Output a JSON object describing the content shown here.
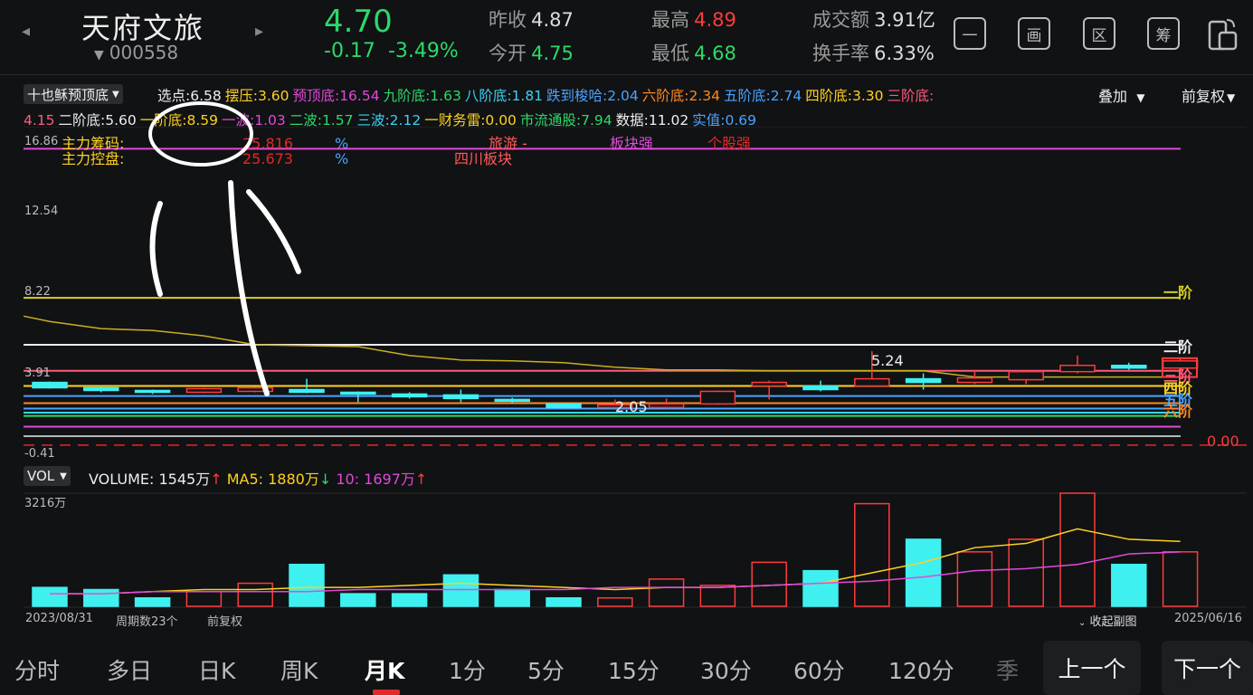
{
  "header": {
    "name": "天府文旅",
    "code": "000558",
    "price": "4.70",
    "change": "-0.17",
    "change_pct": "-3.49%",
    "quotes": [
      {
        "label": "昨收",
        "value": "4.87",
        "color": "#dddddd"
      },
      {
        "label": "今开",
        "value": "4.75",
        "color": "#2bd96a"
      },
      {
        "label": "最高",
        "value": "4.89",
        "color": "#ff3b3b"
      },
      {
        "label": "最低",
        "value": "4.68",
        "color": "#2bd96a"
      },
      {
        "label": "成交额",
        "value": "3.91亿",
        "color": "#dddddd"
      },
      {
        "label": "换手率",
        "value": "6.33%",
        "color": "#dddddd"
      }
    ],
    "tools": [
      "一",
      "画",
      "区",
      "筹"
    ]
  },
  "indicator": {
    "selector": "十也稣预顶底",
    "overlay": "叠加",
    "adjust": "前复权",
    "line1": [
      {
        "t": "选点:6.58",
        "c": "#eeeeee"
      },
      {
        "t": "摆压:3.60",
        "c": "#ffd21f"
      },
      {
        "t": "预顶底:16.54",
        "c": "#e04ad8"
      },
      {
        "t": "九阶底:1.63",
        "c": "#2bd96a"
      },
      {
        "t": "八阶底:1.81",
        "c": "#39d3f0"
      },
      {
        "t": "跌到梭哈:2.04",
        "c": "#4aa3ff"
      },
      {
        "t": "六阶底:2.34",
        "c": "#ff8a1f"
      },
      {
        "t": "五阶底:2.74",
        "c": "#4aa3ff"
      },
      {
        "t": "四阶底:3.30",
        "c": "#ffd21f"
      },
      {
        "t": "三阶底:",
        "c": "#ff5a7a"
      }
    ],
    "line2": [
      {
        "t": "4.15",
        "c": "#ff5a7a"
      },
      {
        "t": "二阶底:5.60",
        "c": "#eeeeee"
      },
      {
        "t": "一阶底:8.59",
        "c": "#ffd21f"
      },
      {
        "t": "一波:1.03",
        "c": "#e04ad8"
      },
      {
        "t": "二波:1.57",
        "c": "#2bd96a"
      },
      {
        "t": "三波:2.12",
        "c": "#39d3f0"
      },
      {
        "t": "一财务雷:0.00",
        "c": "#ffd21f"
      },
      {
        "t": "市流通股:7.94",
        "c": "#2bd96a"
      },
      {
        "t": "数据:11.02",
        "c": "#eeeeee"
      },
      {
        "t": "实值:0.69",
        "c": "#4aa3ff"
      }
    ]
  },
  "main_chart": {
    "y_ticks": [
      "16.86",
      "12.54",
      "8.22",
      "3.91",
      "-0.41"
    ],
    "labels": {
      "chip": "主力筹码:",
      "chip_val": "25.816",
      "control": "主力控盘:",
      "control_val": "25.673",
      "pct": "%",
      "tourism": "旅游 -",
      "sector_strong": "板块强",
      "stock_strong": "个股强",
      "sichuan": "四川板块",
      "high_mark": "5.24",
      "low_mark": "2.05",
      "zero_val": "0.00"
    },
    "levels": [
      {
        "name": "一阶",
        "value": "8.22",
        "color": "#d8d020"
      },
      {
        "name": "二阶",
        "value": "5.60",
        "color": "#eeeeee"
      },
      {
        "name": "三阶",
        "value": "4.15",
        "color": "#ff5a7a"
      },
      {
        "name": "四阶",
        "value": "3.30",
        "color": "#ffd21f"
      },
      {
        "name": "五阶",
        "value": "2.74",
        "color": "#4aa3ff"
      },
      {
        "name": "六阶",
        "value": "2.34",
        "color": "#ff8a1f"
      }
    ]
  },
  "volume": {
    "selector": "VOL",
    "volume_label": "VOLUME: 1545万",
    "ma5_label": "MA5: 1880万",
    "ma10_label": "10: 1697万",
    "max_label": "3216万",
    "start_date": "2023/08/31",
    "period_count": "周期数23个",
    "adjust": "前复权",
    "collapse": "收起副图",
    "end_date": "2025/06/16"
  },
  "tabs": [
    {
      "label": "分时",
      "active": false
    },
    {
      "label": "多日",
      "active": false
    },
    {
      "label": "日K",
      "active": false
    },
    {
      "label": "周K",
      "active": false
    },
    {
      "label": "月K",
      "active": true
    },
    {
      "label": "1分",
      "active": false
    },
    {
      "label": "5分",
      "active": false
    },
    {
      "label": "15分",
      "active": false
    },
    {
      "label": "30分",
      "active": false
    },
    {
      "label": "60分",
      "active": false
    },
    {
      "label": "120分",
      "active": false
    },
    {
      "label": "季",
      "active": false
    }
  ],
  "pager": {
    "prev": "上一个",
    "next": "下一个"
  },
  "chart_data": {
    "type": "candlestick",
    "x": [
      "2023/08/31",
      "",
      "",
      "",
      "",
      "",
      "",
      "",
      "",
      "",
      "",
      "",
      "",
      "",
      "",
      "",
      "",
      "",
      "",
      "",
      "",
      "",
      "2025/06/16"
    ],
    "candles": [
      {
        "o": 3.5,
        "c": 3.2,
        "h": 3.55,
        "l": 3.15,
        "up": false
      },
      {
        "o": 3.2,
        "c": 3.05,
        "h": 3.3,
        "l": 2.95,
        "up": false
      },
      {
        "o": 3.05,
        "c": 2.95,
        "h": 3.1,
        "l": 2.85,
        "up": false
      },
      {
        "o": 2.95,
        "c": 3.15,
        "h": 3.2,
        "l": 2.9,
        "up": true
      },
      {
        "o": 3.0,
        "c": 3.2,
        "h": 3.25,
        "l": 2.95,
        "up": true
      },
      {
        "o": 3.1,
        "c": 2.95,
        "h": 3.7,
        "l": 2.9,
        "up": false
      },
      {
        "o": 2.95,
        "c": 2.85,
        "h": 3.0,
        "l": 2.4,
        "up": false
      },
      {
        "o": 2.85,
        "c": 2.7,
        "h": 2.95,
        "l": 2.6,
        "up": false
      },
      {
        "o": 2.8,
        "c": 2.6,
        "h": 3.1,
        "l": 2.4,
        "up": false
      },
      {
        "o": 2.55,
        "c": 2.45,
        "h": 2.65,
        "l": 2.35,
        "up": false
      },
      {
        "o": 2.3,
        "c": 2.1,
        "h": 2.35,
        "l": 2.05,
        "up": false
      },
      {
        "o": 2.1,
        "c": 2.25,
        "h": 2.55,
        "l": 2.05,
        "up": true
      },
      {
        "o": 2.1,
        "c": 2.3,
        "h": 2.6,
        "l": 2.05,
        "up": true
      },
      {
        "o": 2.3,
        "c": 3.0,
        "h": 3.05,
        "l": 2.25,
        "up": true
      },
      {
        "o": 3.3,
        "c": 3.5,
        "h": 3.6,
        "l": 2.55,
        "up": true
      },
      {
        "o": 3.3,
        "c": 3.1,
        "h": 3.6,
        "l": 3.0,
        "up": false
      },
      {
        "o": 3.3,
        "c": 3.7,
        "h": 5.24,
        "l": 3.25,
        "up": true
      },
      {
        "o": 3.7,
        "c": 3.5,
        "h": 4.0,
        "l": 3.1,
        "up": false
      },
      {
        "o": 3.5,
        "c": 3.75,
        "h": 4.2,
        "l": 3.4,
        "up": true
      },
      {
        "o": 3.65,
        "c": 4.1,
        "h": 4.2,
        "l": 3.4,
        "up": true
      },
      {
        "o": 4.1,
        "c": 4.45,
        "h": 5.0,
        "l": 4.0,
        "up": true
      },
      {
        "o": 4.45,
        "c": 4.3,
        "h": 4.6,
        "l": 4.2,
        "up": false
      },
      {
        "o": 4.3,
        "c": 4.7,
        "h": 4.8,
        "l": 3.9,
        "up": true
      }
    ],
    "yellow_line": [
      6.9,
      6.5,
      6.4,
      6.1,
      5.6,
      5.55,
      5.5,
      5.0,
      4.75,
      4.7,
      4.6,
      4.35,
      4.2,
      4.2,
      4.15,
      4.15,
      4.15,
      4.15,
      3.8,
      3.8,
      3.8,
      3.8,
      3.8
    ],
    "volume": [
      9,
      8,
      4,
      7,
      11,
      20,
      6,
      6,
      15,
      8,
      4,
      4,
      13,
      10,
      21,
      17,
      49,
      32,
      26,
      32,
      54,
      20,
      26
    ],
    "ma5": [
      6,
      6,
      7,
      8,
      8,
      9,
      9,
      10,
      11,
      10,
      9,
      8,
      9,
      9,
      10,
      11,
      16,
      21,
      28,
      30,
      37,
      32,
      31
    ],
    "ma10": [
      6,
      6,
      7,
      7,
      7,
      7,
      8,
      8,
      8,
      8,
      8,
      9,
      9,
      9,
      10,
      11,
      12,
      14,
      17,
      18,
      20,
      25,
      26
    ],
    "ylim": [
      -0.41,
      16.86
    ],
    "vol_max": 3216
  }
}
